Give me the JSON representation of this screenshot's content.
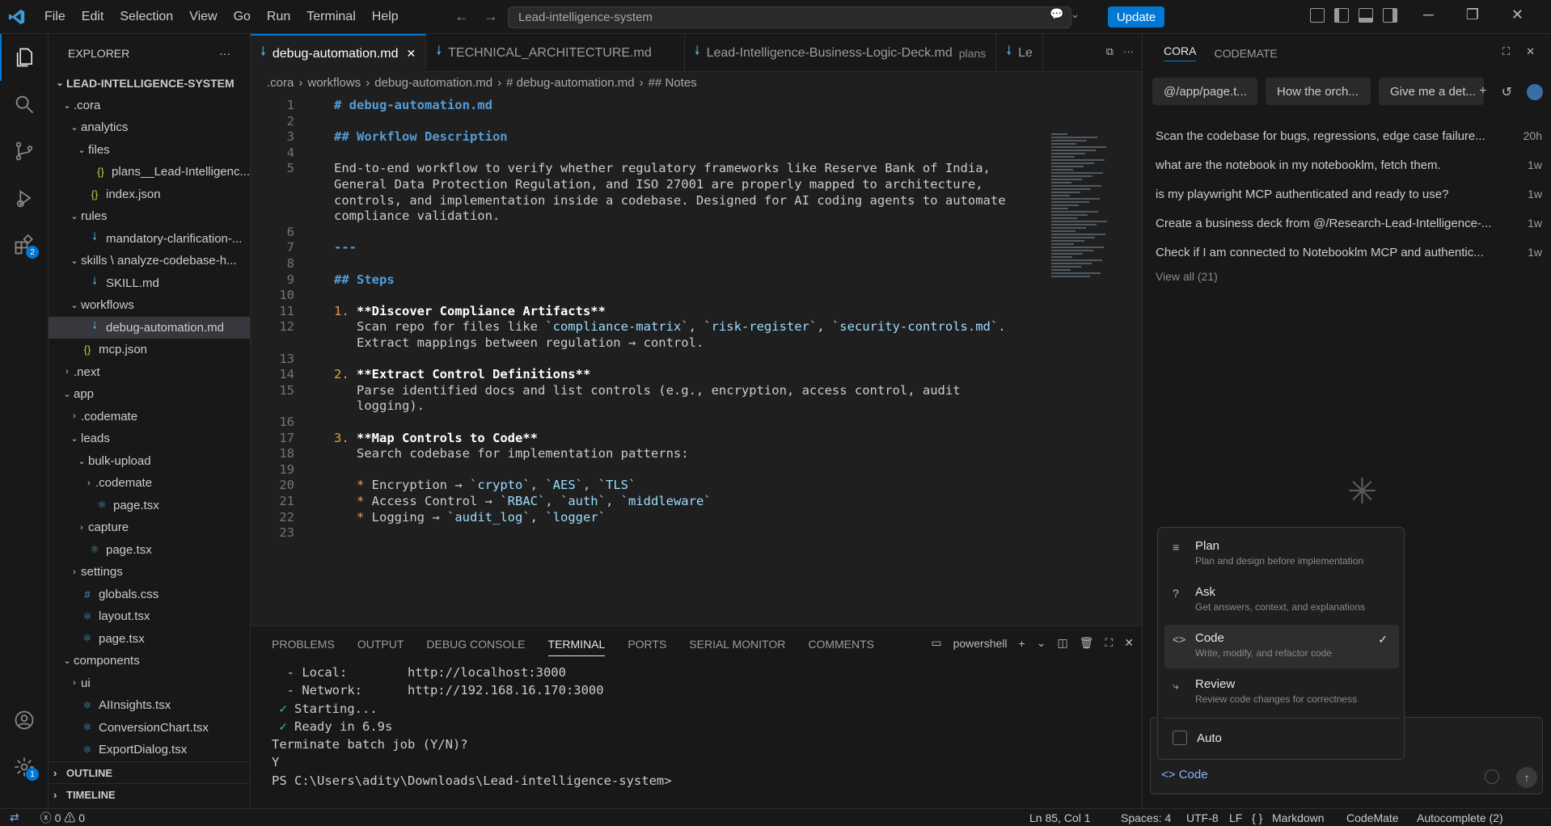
{
  "titlebar": {
    "menu": [
      "File",
      "Edit",
      "Selection",
      "View",
      "Go",
      "Run",
      "Terminal",
      "Help"
    ],
    "search": "Lead-intelligence-system",
    "update": "Update"
  },
  "activity": {
    "extensions_badge": "2",
    "manage_badge": "1"
  },
  "explorer": {
    "title": "EXPLORER",
    "root": "LEAD-INTELLIGENCE-SYSTEM",
    "items": [
      {
        "label": ".cora",
        "indent": 1,
        "chev": "⌄",
        "icon": ""
      },
      {
        "label": "analytics",
        "indent": 2,
        "chev": "⌄",
        "icon": ""
      },
      {
        "label": "files",
        "indent": 3,
        "chev": "⌄",
        "icon": ""
      },
      {
        "label": "plans__Lead-Intelligenc...",
        "indent": 4,
        "chev": "",
        "icon": "json"
      },
      {
        "label": "index.json",
        "indent": 3,
        "chev": "",
        "icon": "json"
      },
      {
        "label": "rules",
        "indent": 2,
        "chev": "⌄",
        "icon": ""
      },
      {
        "label": "mandatory-clarification-...",
        "indent": 3,
        "chev": "",
        "icon": "md"
      },
      {
        "label": "skills \\ analyze-codebase-h...",
        "indent": 2,
        "chev": "⌄",
        "icon": ""
      },
      {
        "label": "SKILL.md",
        "indent": 3,
        "chev": "",
        "icon": "md"
      },
      {
        "label": "workflows",
        "indent": 2,
        "chev": "⌄",
        "icon": ""
      },
      {
        "label": "debug-automation.md",
        "indent": 3,
        "chev": "",
        "icon": "md",
        "selected": true
      },
      {
        "label": "mcp.json",
        "indent": 2,
        "chev": "",
        "icon": "json"
      },
      {
        "label": ".next",
        "indent": 1,
        "chev": "›",
        "icon": ""
      },
      {
        "label": "app",
        "indent": 1,
        "chev": "⌄",
        "icon": ""
      },
      {
        "label": ".codemate",
        "indent": 2,
        "chev": "›",
        "icon": ""
      },
      {
        "label": "leads",
        "indent": 2,
        "chev": "⌄",
        "icon": ""
      },
      {
        "label": "bulk-upload",
        "indent": 3,
        "chev": "⌄",
        "icon": ""
      },
      {
        "label": ".codemate",
        "indent": 4,
        "chev": "›",
        "icon": ""
      },
      {
        "label": "page.tsx",
        "indent": 4,
        "chev": "",
        "icon": "react"
      },
      {
        "label": "capture",
        "indent": 3,
        "chev": "›",
        "icon": ""
      },
      {
        "label": "page.tsx",
        "indent": 3,
        "chev": "",
        "icon": "react"
      },
      {
        "label": "settings",
        "indent": 2,
        "chev": "›",
        "icon": ""
      },
      {
        "label": "globals.css",
        "indent": 2,
        "chev": "",
        "icon": "css"
      },
      {
        "label": "layout.tsx",
        "indent": 2,
        "chev": "",
        "icon": "react"
      },
      {
        "label": "page.tsx",
        "indent": 2,
        "chev": "",
        "icon": "react"
      },
      {
        "label": "components",
        "indent": 1,
        "chev": "⌄",
        "icon": ""
      },
      {
        "label": "ui",
        "indent": 2,
        "chev": "›",
        "icon": ""
      },
      {
        "label": "AIInsights.tsx",
        "indent": 2,
        "chev": "",
        "icon": "react"
      },
      {
        "label": "ConversionChart.tsx",
        "indent": 2,
        "chev": "",
        "icon": "react"
      },
      {
        "label": "ExportDialog.tsx",
        "indent": 2,
        "chev": "",
        "icon": "react"
      }
    ],
    "outline": "OUTLINE",
    "timeline": "TIMELINE"
  },
  "editor": {
    "tabs": [
      {
        "label": "debug-automation.md",
        "sub": "",
        "active": true
      },
      {
        "label": "TECHNICAL_ARCHITECTURE.md",
        "sub": "",
        "active": false
      },
      {
        "label": "Lead-Intelligence-Business-Logic-Deck.md",
        "sub": "plans",
        "active": false
      },
      {
        "label": "Le",
        "sub": "",
        "active": false
      }
    ],
    "breadcrumb": [
      ".cora",
      "workflows",
      "debug-automation.md",
      "# debug-automation.md",
      "## Notes"
    ],
    "lines": [
      {
        "n": "1",
        "html": "<span class='h'># debug-automation.md</span>"
      },
      {
        "n": "2",
        "html": ""
      },
      {
        "n": "3",
        "html": "<span class='h'>## Workflow Description</span>"
      },
      {
        "n": "4",
        "html": ""
      },
      {
        "n": "5",
        "html": "End-to-end workflow to verify whether regulatory frameworks like Reserve Bank of India,"
      },
      {
        "n": "",
        "html": "General Data Protection Regulation, and ISO 27001 are properly mapped to architecture,"
      },
      {
        "n": "",
        "html": "controls, and implementation inside a codebase. Designed for AI coding agents to automate"
      },
      {
        "n": "",
        "html": "compliance validation."
      },
      {
        "n": "6",
        "html": ""
      },
      {
        "n": "7",
        "html": "<span class='h'>---</span>"
      },
      {
        "n": "8",
        "html": ""
      },
      {
        "n": "9",
        "html": "<span class='h'>## Steps</span>"
      },
      {
        "n": "10",
        "html": ""
      },
      {
        "n": "11",
        "html": "<span class='num'>1.</span> <span class='bold'>**Discover Compliance Artifacts**</span>"
      },
      {
        "n": "12",
        "html": "   Scan repo for files like `<span class='inl'>compliance-matrix</span>`, `<span class='inl'>risk-register</span>`, `<span class='inl'>security-controls.md</span>`."
      },
      {
        "n": "",
        "html": "   Extract mappings between regulation → control."
      },
      {
        "n": "13",
        "html": ""
      },
      {
        "n": "14",
        "html": "<span class='num'>2.</span> <span class='bold'>**Extract Control Definitions**</span>"
      },
      {
        "n": "15",
        "html": "   Parse identified docs and list controls (e.g., encryption, access control, audit"
      },
      {
        "n": "",
        "html": "   logging)."
      },
      {
        "n": "16",
        "html": ""
      },
      {
        "n": "17",
        "html": "<span class='num'>3.</span> <span class='bold'>**Map Controls to Code**</span>"
      },
      {
        "n": "18",
        "html": "   Search codebase for implementation patterns:"
      },
      {
        "n": "19",
        "html": ""
      },
      {
        "n": "20",
        "html": "   <span class='num'>*</span> Encryption → `<span class='inl'>crypto</span>`, `<span class='inl'>AES</span>`, `<span class='inl'>TLS</span>`"
      },
      {
        "n": "21",
        "html": "   <span class='num'>*</span> Access Control → `<span class='inl'>RBAC</span>`, `<span class='inl'>auth</span>`, `<span class='inl'>middleware</span>`"
      },
      {
        "n": "22",
        "html": "   <span class='num'>*</span> Logging → `<span class='inl'>audit_log</span>`, `<span class='inl'>logger</span>`"
      },
      {
        "n": "23",
        "html": ""
      }
    ]
  },
  "panel": {
    "tabs": [
      "PROBLEMS",
      "OUTPUT",
      "DEBUG CONSOLE",
      "TERMINAL",
      "PORTS",
      "SERIAL MONITOR",
      "COMMENTS"
    ],
    "active_tab": "TERMINAL",
    "shell": "powershell",
    "terminal_lines": [
      "  - Local:        http://localhost:3000",
      "  - Network:      http://192.168.16.170:3000",
      "",
      " ✓ Starting...",
      " ✓ Ready in 6.9s",
      "Terminate batch job (Y/N)?",
      "Y",
      "PS C:\\Users\\adity\\Downloads\\Lead-intelligence-system>"
    ]
  },
  "chat": {
    "tabs": [
      "CORA",
      "CODEMATE"
    ],
    "chips": [
      "@/app/page.t...",
      "How the orch...",
      "Give me a det..."
    ],
    "history": [
      {
        "text": "Scan the codebase for bugs, regressions, edge case failure...",
        "age": "20h"
      },
      {
        "text": "what are the notebook in my notebooklm, fetch them.",
        "age": "1w"
      },
      {
        "text": "is my playwright MCP authenticated and ready to use?",
        "age": "1w"
      },
      {
        "text": "Create a business deck from @/Research-Lead-Intelligence-...",
        "age": "1w"
      },
      {
        "text": "Check if I am connected to Notebooklm MCP and authentic...",
        "age": "1w"
      }
    ],
    "view_all": "View all (21)",
    "modes": [
      {
        "title": "Plan",
        "desc": "Plan and design before implementation",
        "icon": "≡"
      },
      {
        "title": "Ask",
        "desc": "Get answers, context, and explanations",
        "icon": "?"
      },
      {
        "title": "Code",
        "desc": "Write, modify, and refactor code",
        "icon": "<>"
      },
      {
        "title": "Review",
        "desc": "Review code changes for correctness",
        "icon": "⤷"
      }
    ],
    "selected_mode": "Code",
    "auto": "Auto",
    "current_mode": "Code"
  },
  "status": {
    "errors": "0",
    "warnings": "0",
    "position": "Ln 85, Col 1",
    "spaces": "Spaces: 4",
    "encoding": "UTF-8",
    "eol": "LF",
    "language": "Markdown",
    "ext": "CodeMate",
    "autocomplete": "Autocomplete (2)"
  }
}
